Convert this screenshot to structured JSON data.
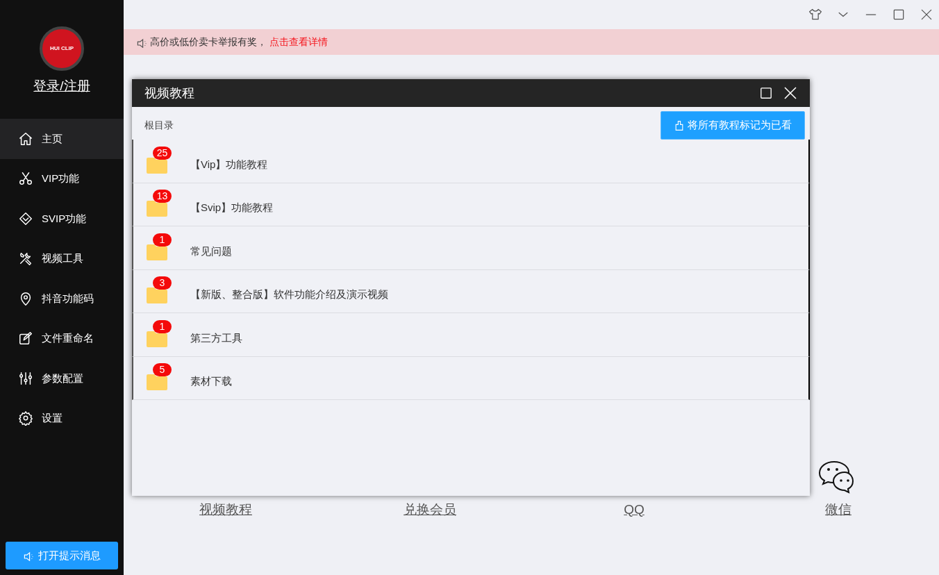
{
  "sidebar": {
    "logo": {
      "text": "HUI CLIP"
    },
    "login": "登录/注册",
    "items": [
      {
        "label": "主页",
        "selected": true
      },
      {
        "label": "VIP功能",
        "selected": false
      },
      {
        "label": "SVIP功能",
        "selected": false
      },
      {
        "label": "视频工具",
        "selected": false
      },
      {
        "label": "抖音功能码",
        "selected": false
      },
      {
        "label": "文件重命名",
        "selected": false
      },
      {
        "label": "参数配置",
        "selected": false
      },
      {
        "label": "设置",
        "selected": false
      }
    ],
    "notify_button": "打开提示消息"
  },
  "banner": {
    "text": "高价或低价卖卡举报有奖，",
    "link": "点击查看详情"
  },
  "shortcuts": [
    {
      "label": "视频教程"
    },
    {
      "label": "兑换会员"
    },
    {
      "label": "QQ"
    },
    {
      "label": "微信"
    }
  ],
  "dialog": {
    "title": "视频教程",
    "breadcrumb": "根目录",
    "mark_all_button": "将所有教程标记为已看",
    "folders": [
      {
        "name": "【Vip】功能教程",
        "count": "25"
      },
      {
        "name": "【Svip】功能教程",
        "count": "13"
      },
      {
        "name": "常见问题",
        "count": "1"
      },
      {
        "name": "【新版、整合版】软件功能介绍及演示视频",
        "count": "3"
      },
      {
        "name": "第三方工具",
        "count": "1"
      },
      {
        "name": "素材下载",
        "count": "5"
      }
    ]
  }
}
